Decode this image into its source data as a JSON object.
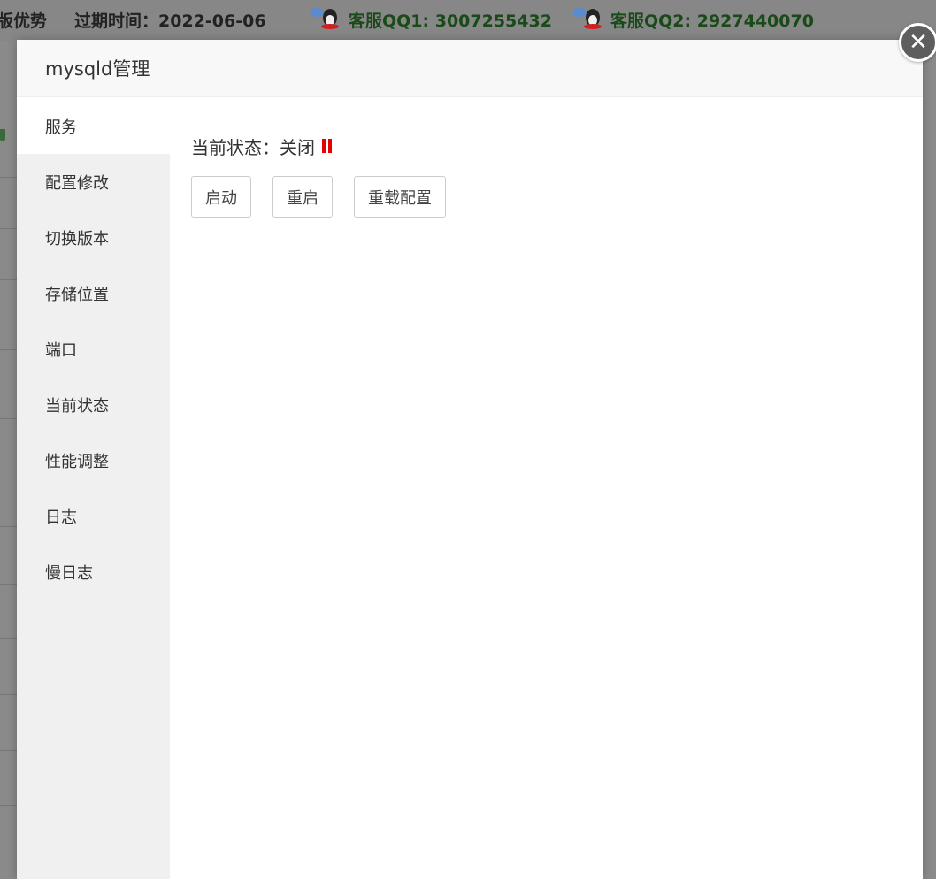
{
  "background": {
    "topbar": {
      "left_text": "版优势",
      "expire_label": "过期时间：2022-06-06",
      "qq1": "客服QQ1: 3007255432",
      "qq2": "客服QQ2: 2927440070"
    }
  },
  "modal": {
    "title": "mysqld管理",
    "close_icon": "close-icon",
    "sidebar": {
      "items": [
        {
          "label": "服务",
          "active": true
        },
        {
          "label": "配置修改",
          "active": false
        },
        {
          "label": "切换版本",
          "active": false
        },
        {
          "label": "存储位置",
          "active": false
        },
        {
          "label": "端口",
          "active": false
        },
        {
          "label": "当前状态",
          "active": false
        },
        {
          "label": "性能调整",
          "active": false
        },
        {
          "label": "日志",
          "active": false
        },
        {
          "label": "慢日志",
          "active": false
        }
      ]
    },
    "content": {
      "status_label": "当前状态：关闭",
      "status_icon": "pause-icon",
      "status_color": "#e60000",
      "buttons": {
        "start": "启动",
        "restart": "重启",
        "reload": "重载配置"
      }
    }
  }
}
